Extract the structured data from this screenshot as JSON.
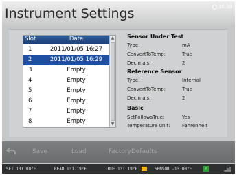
{
  "title": "Instrument Settings",
  "clock": "16:38",
  "slot_list": {
    "headers": {
      "slot": "Slot",
      "date": "Date"
    },
    "rows": [
      {
        "slot": "1",
        "date": "2011/01/05 16:27",
        "selected": false
      },
      {
        "slot": "2",
        "date": "2011/01/05 16:29",
        "selected": true
      },
      {
        "slot": "3",
        "date": "Empty",
        "selected": false
      },
      {
        "slot": "4",
        "date": "Empty",
        "selected": false
      },
      {
        "slot": "5",
        "date": "Empty",
        "selected": false
      },
      {
        "slot": "6",
        "date": "Empty",
        "selected": false
      },
      {
        "slot": "7",
        "date": "Empty",
        "selected": false
      },
      {
        "slot": "8",
        "date": "Empty",
        "selected": false
      }
    ]
  },
  "sensor_under_test": {
    "heading": "Sensor Under Test",
    "type_label": "Type:",
    "type_value": "mA",
    "convert_label": "ConvertToTemp:",
    "convert_value": "True",
    "decimals_label": "Decimals:",
    "decimals_value": "2"
  },
  "reference_sensor": {
    "heading": "Reference Sensor",
    "type_label": "Type:",
    "type_value": "Internal",
    "convert_label": "ConvertToTemp:",
    "convert_value": "True",
    "decimals_label": "Decimals:",
    "decimals_value": "2"
  },
  "basic": {
    "heading": "Basic",
    "setfollows_label": "SetFollowsTrue:",
    "setfollows_value": "Yes",
    "unit_label": "Temperature unit:",
    "unit_value": "Fahrenheit"
  },
  "toolbar": {
    "back_icon": "back-arrow-icon",
    "save": "Save",
    "load": "Load",
    "factory": "FactoryDefaults"
  },
  "status": {
    "set": "SET  131.00°F",
    "read": "READ  131.19°F",
    "true": "TRUE  131.19°F",
    "sensor": "SENSOR  -13.00°F",
    "true_flag_color": "#f2b400",
    "sensor_ok_color": "#27a030"
  }
}
